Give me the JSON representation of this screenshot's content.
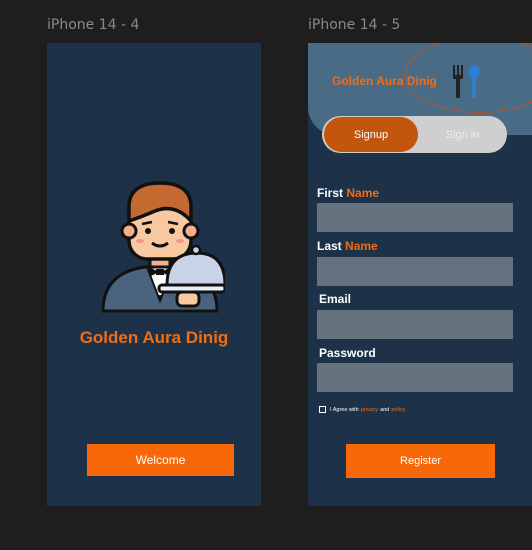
{
  "frames": [
    {
      "label": "iPhone 14 - 4"
    },
    {
      "label": "iPhone 14 - 5"
    }
  ],
  "splash": {
    "title": "Golden Aura Dinig",
    "welcome_label": "Welcome"
  },
  "signup": {
    "brand": "Golden Aura Dinig",
    "tabs": {
      "signup": "Signup",
      "signin": "Sign in"
    },
    "fields": {
      "first_name": {
        "label_a": "First",
        "label_b": "Name"
      },
      "last_name": {
        "label_a": "Last",
        "label_b": "Name"
      },
      "email": {
        "label": "Email"
      },
      "password": {
        "label": "Password"
      }
    },
    "agree": {
      "prefix": "I Agree with",
      "privacy": "privacy",
      "and": "and",
      "policy": "policy"
    },
    "register_label": "Register"
  },
  "colors": {
    "accent": "#f36b12",
    "frame_bg": "#1d3248",
    "canvas": "#1e1e1e"
  }
}
